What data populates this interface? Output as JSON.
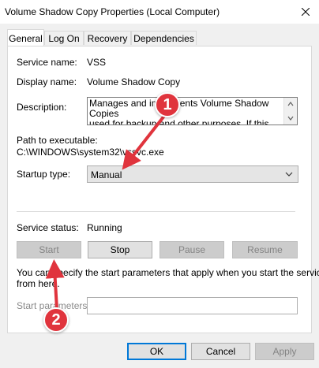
{
  "window": {
    "title": "Volume Shadow Copy Properties (Local Computer)"
  },
  "tabs": [
    {
      "label": "General"
    },
    {
      "label": "Log On"
    },
    {
      "label": "Recovery"
    },
    {
      "label": "Dependencies"
    }
  ],
  "general": {
    "service_name_label": "Service name:",
    "service_name_value": "VSS",
    "display_name_label": "Display name:",
    "display_name_value": "Volume Shadow Copy",
    "description_label": "Description:",
    "description_line1": "Manages and implements Volume Shadow Copies",
    "description_line2": "used for backup and other purposes. If this service",
    "path_label": "Path to executable:",
    "path_value": "C:\\WINDOWS\\system32\\vssvc.exe",
    "startup_type_label": "Startup type:",
    "startup_type_value": "Manual",
    "service_status_label": "Service status:",
    "service_status_value": "Running",
    "buttons": {
      "start": "Start",
      "stop": "Stop",
      "pause": "Pause",
      "resume": "Resume"
    },
    "help_text_line1": "You can specify the start parameters that apply when you start the service",
    "help_text_line2": "from here.",
    "start_params_label": "Start parameters:",
    "start_params_value": ""
  },
  "footer": {
    "ok": "OK",
    "cancel": "Cancel",
    "apply": "Apply"
  },
  "annotations": {
    "badge1": "1",
    "badge2": "2",
    "color": "#e0343d"
  }
}
